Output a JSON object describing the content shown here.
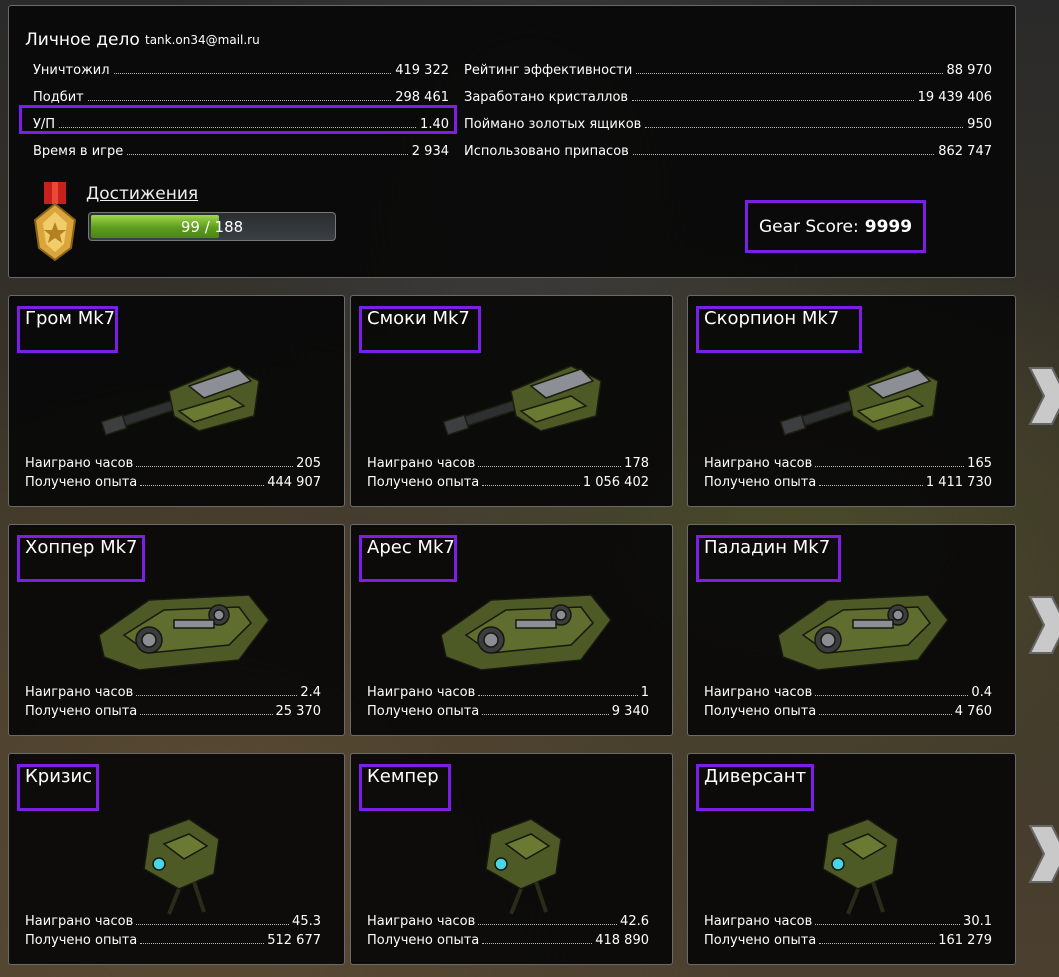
{
  "profile": {
    "title": "Личное дело",
    "email": "tank.on34@mail.ru",
    "stats_left": [
      {
        "label": "Уничтожил",
        "value": "419 322"
      },
      {
        "label": "Подбит",
        "value": "298 461"
      },
      {
        "label": "У/П",
        "value": "1.40"
      },
      {
        "label": "Время в игре",
        "value": "2 934"
      }
    ],
    "stats_right": [
      {
        "label": "Рейтинг эффективности",
        "value": "88 970"
      },
      {
        "label": "Заработано кристаллов",
        "value": "19 439 406"
      },
      {
        "label": "Поймано золотых ящиков",
        "value": "950"
      },
      {
        "label": "Использовано припасов",
        "value": "862 747"
      }
    ],
    "achievements": {
      "label": "Достижения",
      "progress_text": "99 / 188",
      "current": 99,
      "total": 188
    },
    "gear_score": {
      "label": "Gear Score:",
      "value": "9999"
    }
  },
  "colors": {
    "highlight": "#7b1fe6",
    "progress": "#7dbf2c",
    "panel": "#0a0a0a"
  },
  "cards": [
    {
      "title": "Гром Mk7",
      "art": "turret-cannon",
      "hours_label": "Наиграно часов",
      "hours": "205",
      "xp_label": "Получено опыта",
      "xp": "444 907"
    },
    {
      "title": "Смоки Mk7",
      "art": "turret-cannon",
      "hours_label": "Наиграно часов",
      "hours": "178",
      "xp_label": "Получено опыта",
      "xp": "1 056 402"
    },
    {
      "title": "Скорпион Mk7",
      "art": "turret-cannon",
      "hours_label": "Наиграно часов",
      "hours": "165",
      "xp_label": "Получено опыта",
      "xp": "1 411 730"
    },
    {
      "title": "Хоппер Mk7",
      "art": "hull",
      "hours_label": "Наиграно часов",
      "hours": "2.4",
      "xp_label": "Получено опыта",
      "xp": "25 370"
    },
    {
      "title": "Арес Mk7",
      "art": "hull",
      "hours_label": "Наиграно часов",
      "hours": "1",
      "xp_label": "Получено опыта",
      "xp": "9 340"
    },
    {
      "title": "Паладин Mk7",
      "art": "hull",
      "hours_label": "Наиграно часов",
      "hours": "0.4",
      "xp_label": "Получено опыта",
      "xp": "4 760"
    },
    {
      "title": "Кризис",
      "art": "drone",
      "hours_label": "Наиграно часов",
      "hours": "45.3",
      "xp_label": "Получено опыта",
      "xp": "512 677"
    },
    {
      "title": "Кемпер",
      "art": "drone",
      "hours_label": "Наиграно часов",
      "hours": "42.6",
      "xp_label": "Получено опыта",
      "xp": "418 890"
    },
    {
      "title": "Диверсант",
      "art": "drone",
      "hours_label": "Наиграно часов",
      "hours": "30.1",
      "xp_label": "Получено опыта",
      "xp": "161 279"
    }
  ],
  "icons": {
    "medal": "medal-icon",
    "next": "chevron-right-icon"
  }
}
